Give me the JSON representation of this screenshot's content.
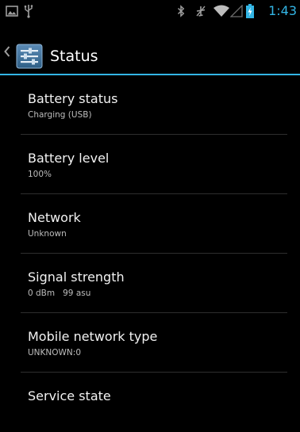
{
  "status_bar": {
    "time": "1:43",
    "icons": [
      "gallery-icon",
      "usb-icon",
      "bluetooth-icon",
      "airplane-off-icon",
      "wifi-icon",
      "signal-icon",
      "battery-charging-icon"
    ]
  },
  "action_bar": {
    "title": "Status"
  },
  "items": [
    {
      "title": "Battery status",
      "summary": "Charging (USB)"
    },
    {
      "title": "Battery level",
      "summary": "100%"
    },
    {
      "title": "Network",
      "summary": "Unknown"
    },
    {
      "title": "Signal strength",
      "summary": "0 dBm   99 asu"
    },
    {
      "title": "Mobile network type",
      "summary": "UNKNOWN:0"
    },
    {
      "title": "Service state",
      "summary": ""
    }
  ],
  "colors": {
    "accent": "#33b5e5",
    "background": "#000000"
  }
}
